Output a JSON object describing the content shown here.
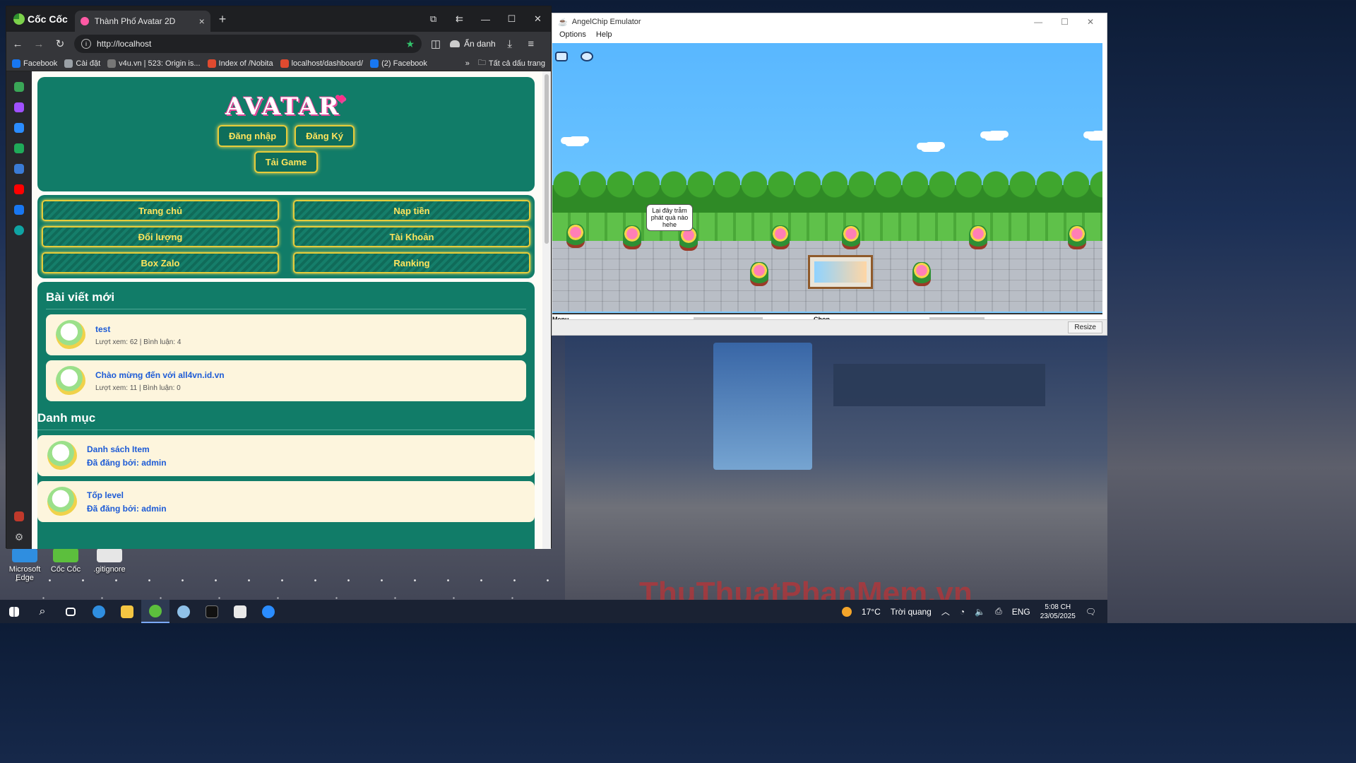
{
  "browser": {
    "brand": "Cốc Cốc",
    "tab_title": "Thành Phố Avatar 2D",
    "tab_close": "×",
    "new_tab": "+",
    "url": "http://localhost",
    "incognito_label": "Ẩn danh",
    "bookmarks": [
      {
        "label": "Facebook",
        "color": "#1877f2"
      },
      {
        "label": "Cài đặt",
        "color": "#9aa0a6"
      },
      {
        "label": "v4u.vn | 523: Origin is...",
        "color": "#777777"
      },
      {
        "label": "Index of /Nobita",
        "color": "#e04a2f"
      },
      {
        "label": "localhost/dashboard/",
        "color": "#e04a2f"
      },
      {
        "label": "(2) Facebook",
        "color": "#1877f2"
      }
    ],
    "bookmarks_more": "»",
    "all_bookmarks": "Tất cả dấu trang"
  },
  "site": {
    "logo": "AVATAR",
    "login": "Đăng nhập",
    "register": "Đăng Ký",
    "download": "Tải Game",
    "menu": [
      "Trang chủ",
      "Nạp tiền",
      "Đổi lượng",
      "Tài Khoản",
      "Box Zalo",
      "Ranking"
    ],
    "posts_title": "Bài viết mới",
    "posts": [
      {
        "title": "test",
        "meta": "Lượt xem: 62 | Bình luận: 4"
      },
      {
        "title": "Chào mừng đến với all4vn.id.vn",
        "meta": "Lượt xem: 11 | Bình luận: 0"
      }
    ],
    "categories_title": "Danh mục",
    "categories": [
      {
        "name": "Danh sách Item",
        "by": "Đã đăng bởi: admin"
      },
      {
        "name": "Tốp level",
        "by": "Đã đăng bởi: admin"
      }
    ]
  },
  "emulator": {
    "title": "AngelChip Emulator",
    "menu": [
      "Options",
      "Help"
    ],
    "bubble": "Lại đây trẫm phát quà nào hehe",
    "bottom_left": "Menu",
    "bottom_center": "Chọn",
    "resize": "Resize"
  },
  "desktop": {
    "icons": [
      "Microsoft Edge",
      "Cốc Cốc",
      ".gitignore"
    ],
    "watermark": "ThuThuatPhanMem.vn"
  },
  "taskbar": {
    "temperature": "17°C",
    "weather": "Trời quang",
    "lang": "ENG",
    "time": "5:08 CH",
    "date": "23/05/2025"
  }
}
